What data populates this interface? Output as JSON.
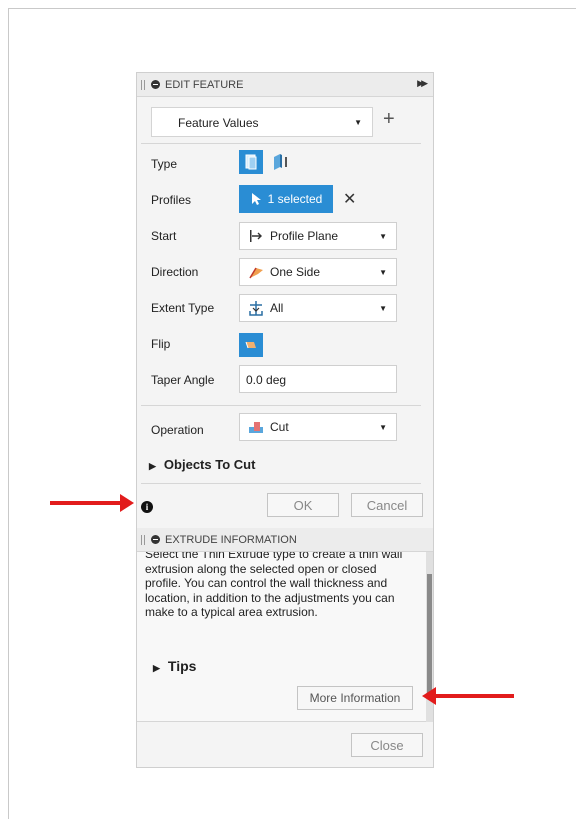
{
  "edit_feature": {
    "title": "EDIT FEATURE",
    "dropdown_value": "Feature Values",
    "rows": {
      "type_label": "Type",
      "profiles_label": "Profiles",
      "profiles_value": "1 selected",
      "start_label": "Start",
      "start_value": "Profile Plane",
      "direction_label": "Direction",
      "direction_value": "One Side",
      "extent_label": "Extent Type",
      "extent_value": "All",
      "flip_label": "Flip",
      "taper_label": "Taper Angle",
      "taper_value": "0.0 deg",
      "operation_label": "Operation",
      "operation_value": "Cut"
    },
    "objects_to_cut": "Objects To Cut",
    "ok_label": "OK",
    "cancel_label": "Cancel"
  },
  "extrude_info": {
    "title": "EXTRUDE INFORMATION",
    "text": "Select the Thin Extrude type to create a thin wall extrusion along the selected open or closed profile. You can control the wall thickness and location, in addition to the adjustments you can make to a typical area extrusion.",
    "tips": "Tips",
    "more_info_label": "More Information",
    "close_label": "Close"
  },
  "colors": {
    "accent": "#2a8dd4",
    "arrow": "#e21c1c"
  }
}
